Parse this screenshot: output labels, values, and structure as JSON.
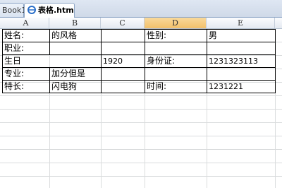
{
  "tabs": [
    {
      "label": "Book1"
    },
    {
      "label": "表格.htm"
    }
  ],
  "columns": [
    "A",
    "B",
    "C",
    "D",
    "E"
  ],
  "selected_column": "D",
  "form": {
    "r1": {
      "a": "姓名:",
      "b": "的风格",
      "c": "",
      "d": "性别:",
      "e": "男"
    },
    "r2": {
      "a": "职业:",
      "b": "",
      "c": "",
      "d": "",
      "e": ""
    },
    "r3": {
      "a": "生日",
      "c": "1920",
      "d": "身份证:",
      "e": "1231323113"
    },
    "r4": {
      "a": "专业:",
      "b": "加分但是",
      "c": "",
      "d": "",
      "e": ""
    },
    "r5": {
      "a": "特长:",
      "b": "闪电狗",
      "c": "",
      "d": "时间:",
      "e": "1231221"
    }
  },
  "colors": {
    "selected_header": "#f2c06a",
    "gridline": "#dadcdd",
    "tab_border": "#8ea6c6"
  }
}
